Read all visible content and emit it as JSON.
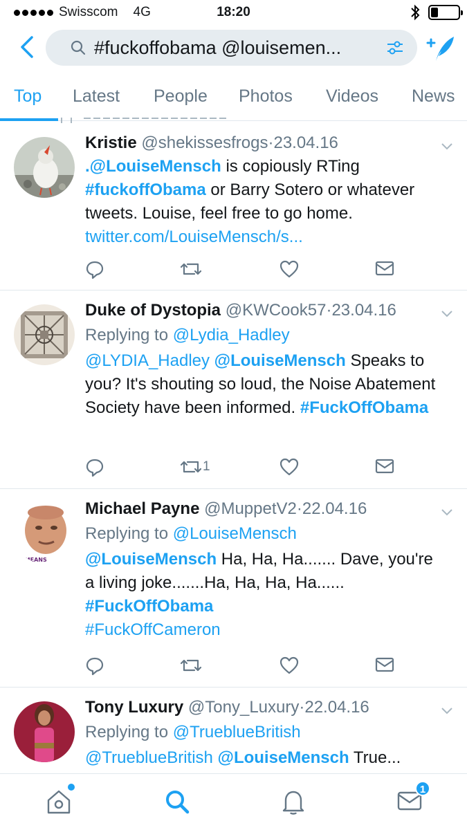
{
  "status_bar": {
    "carrier": "Swisscom",
    "network": "4G",
    "time": "18:20",
    "battery_level": 0.25
  },
  "search": {
    "query": "#fuckoffobama @louisemen..."
  },
  "tabs": [
    {
      "label": "Top",
      "active": true
    },
    {
      "label": "Latest"
    },
    {
      "label": "People"
    },
    {
      "label": "Photos"
    },
    {
      "label": "Videos"
    },
    {
      "label": "News"
    }
  ],
  "tweets": [
    {
      "name": "Kristie",
      "handle": "@shekissesfrogs",
      "sep": "·",
      "date": "23.04.16",
      "text": {
        "mention": ".@LouiseMensch",
        "part1": " is copiously RTing ",
        "tag": "#fuckoffObama",
        "part2": " or Barry Sotero or whatever tweets. Louise, feel free to go home. ",
        "link": "twitter.com/LouiseMensch/s..."
      },
      "retweets": ""
    },
    {
      "name": "Duke of Dystopia",
      "handle": "@KWCook57",
      "sep": "·",
      "date": "23.04.16",
      "replying_prefix": "Replying to ",
      "replying_to": "@Lydia_Hadley",
      "text": {
        "mention1": "@LYDIA_Hadley",
        "mention2": "@LouiseMensch",
        "part1": " Speaks to you? It's shouting so loud, the Noise Abatement Society have been informed. ",
        "tag": "#FuckOffObama"
      },
      "retweets": "1"
    },
    {
      "name": "Michael Payne",
      "handle": "@MuppetV2",
      "sep": "·",
      "date": "22.04.16",
      "replying_prefix": "Replying to ",
      "replying_to": "@LouiseMensch",
      "avatar_caption": "VEMEANS",
      "text": {
        "mention": "@LouiseMensch",
        "part1": " Ha, Ha, Ha....... Dave, you're a living joke.......Ha, Ha, Ha, Ha...... ",
        "tag1": "#FuckOffObama",
        "tag2": "#FuckOffCameron"
      },
      "retweets": ""
    },
    {
      "name": "Tony Luxury",
      "handle": "@Tony_Luxury",
      "sep": "·",
      "date": "22.04.16",
      "replying_prefix": "Replying to ",
      "replying_to": "@TrueblueBritish",
      "text": {
        "mention1": "@TrueblueBritish",
        "mention2": "@LouiseMensch",
        "part1": "  True..."
      }
    }
  ],
  "bottom_nav": {
    "items": [
      "home-icon",
      "search-icon",
      "notifications-icon",
      "messages-icon"
    ],
    "messages_badge": "1"
  },
  "colors": {
    "accent": "#1da1f2",
    "muted": "#657786",
    "divider": "#e1e8ed",
    "search_bg": "#e6ecf0"
  }
}
